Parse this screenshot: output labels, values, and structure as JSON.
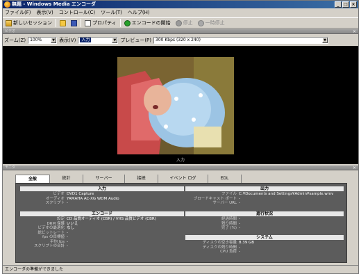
{
  "window": {
    "title": "無題 - Windows Media エンコーダ",
    "controls": [
      "_",
      "□",
      "×"
    ]
  },
  "menu": [
    "ファイル(F)",
    "表示(V)",
    "コントロール(C)",
    "ツール(T)",
    "ヘルプ(H)"
  ],
  "toolbar": {
    "new_session": "新しいセッション",
    "properties": "プロパティ",
    "start_encoding": "エンコードの開始",
    "stop": "停止",
    "pause": "一時停止"
  },
  "video_pane": {
    "header_label": "ビデオ",
    "zoom_label": "ズーム(Z)",
    "zoom_value": "100%",
    "view_label": "表示(V)",
    "view_value": "入力",
    "preview_label": "プレビュー(P)",
    "preview_value": "300 Kbps (320 x 240)",
    "input_caption": "入力"
  },
  "info_pane": {
    "header_label": "モニタ",
    "tabs": [
      "全般",
      "統計",
      "サーバー",
      "接続",
      "イベント ログ",
      "EDL"
    ],
    "input": {
      "title": "入力",
      "rows": [
        {
          "k": "ビデオ",
          "v": "DVD1 Capture"
        },
        {
          "k": "オーディオ",
          "v": "YAMAHA AC-XG WDM Audio"
        },
        {
          "k": "スクリプト",
          "v": "-"
        }
      ]
    },
    "encode": {
      "title": "エンコード",
      "rows": [
        {
          "k": "設定",
          "v": "CD 品質オーディオ (CBR) / VHS 品質ビデオ (CBR)"
        },
        {
          "k": "DRM 保護",
          "v": "いいえ"
        },
        {
          "k": "ビデオの最適化",
          "v": "なし"
        },
        {
          "k": "総ビットレート",
          "v": "-"
        },
        {
          "k": "fps の目標値",
          "v": "-"
        },
        {
          "k": "平均 fps",
          "v": "-"
        },
        {
          "k": "スクリプトの合計",
          "v": "-"
        }
      ]
    },
    "output": {
      "title": "出力",
      "rows": [
        {
          "k": "ファイル",
          "v": "C:¥Documents and Settings¥Admin¥sample.wmv"
        },
        {
          "k": "ブロードキャスト ポート",
          "v": "-"
        },
        {
          "k": "サーバー URL",
          "v": "-"
        }
      ]
    },
    "progress": {
      "title": "進行状況",
      "rows": [
        {
          "k": "経過時間",
          "v": "-"
        },
        {
          "k": "残り時間",
          "v": "-"
        },
        {
          "k": "完了 (%)",
          "v": "-"
        }
      ]
    },
    "system": {
      "title": "システム",
      "rows": [
        {
          "k": "ディスクの空き容量",
          "v": "8.39 GB"
        },
        {
          "k": "ディスクの残り時間",
          "v": "-"
        },
        {
          "k": "CPU 負荷",
          "v": "-"
        }
      ]
    }
  },
  "status": "エンコーダの準備ができました"
}
